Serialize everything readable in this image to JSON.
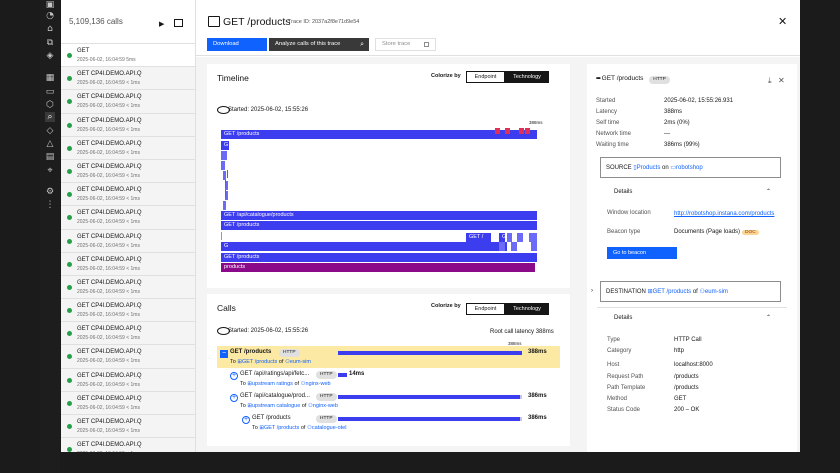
{
  "list": {
    "count": "5,109,136 calls",
    "items": [
      {
        "name": "GET",
        "meta": "2025-06-02, 16:04:59 5ms"
      },
      {
        "name": "GET CP4I.DEMO.API.Q",
        "meta": "2025-06-02, 16:04:59 < 1ms"
      },
      {
        "name": "GET CP4I.DEMO.API.Q",
        "meta": "2025-06-02, 16:04:59 < 1ms"
      },
      {
        "name": "GET CP4I.DEMO.API.Q",
        "meta": "2025-06-02, 16:04:59 < 1ms"
      },
      {
        "name": "GET CP4I.DEMO.API.Q",
        "meta": "2025-06-02, 16:04:59 < 1ms"
      },
      {
        "name": "GET CP4I.DEMO.API.Q",
        "meta": "2025-06-02, 16:04:59 < 1ms"
      },
      {
        "name": "GET CP4I.DEMO.API.Q",
        "meta": "2025-06-02, 16:04:59 < 1ms"
      },
      {
        "name": "GET CP4I.DEMO.API.Q",
        "meta": "2025-06-02, 16:04:59 < 1ms"
      },
      {
        "name": "GET CP4I.DEMO.API.Q",
        "meta": "2025-06-02, 16:04:59 < 1ms"
      },
      {
        "name": "GET CP4I.DEMO.API.Q",
        "meta": "2025-06-02, 16:04:59 < 1ms"
      },
      {
        "name": "GET CP4I.DEMO.API.Q",
        "meta": "2025-06-02, 16:04:59 < 1ms"
      },
      {
        "name": "GET CP4I.DEMO.API.Q",
        "meta": "2025-06-02, 16:04:59 < 1ms"
      },
      {
        "name": "GET CP4I.DEMO.API.Q",
        "meta": "2025-06-02, 16:04:59 < 1ms"
      },
      {
        "name": "GET CP4I.DEMO.API.Q",
        "meta": "2025-06-02, 16:04:59 < 1ms"
      },
      {
        "name": "GET CP4I.DEMO.API.Q",
        "meta": "2025-06-02, 16:04:59 < 1ms"
      },
      {
        "name": "GET CP4I.DEMO.API.Q",
        "meta": "2025-06-02, 16:04:59 < 1ms"
      },
      {
        "name": "GET CP4I.DEMO.API.Q",
        "meta": "2025-06-02, 16:04:59 < 1ms"
      },
      {
        "name": "GET CP4I.DEMO.API.Q",
        "meta": "2025-06-02, 16:04:59 < 1ms"
      }
    ]
  },
  "header": {
    "title": "GET /products",
    "trace_id": "Trace ID: 2037a2f8e71d9e54",
    "download": "Download",
    "analyze": "Analyze calls of this trace",
    "store": "Store trace"
  },
  "timeline": {
    "title": "Timeline",
    "colorize": "Colorize by",
    "opt_endpoint": "Endpoint",
    "opt_technology": "Technology",
    "started": "Started: 2025-06-02, 15:55:26",
    "total": "388ms",
    "bars": [
      {
        "label": "GET /products"
      },
      {
        "label": "G"
      },
      {
        "label": "GET /api/catalogue/products"
      },
      {
        "label": "GET /products"
      },
      {
        "label": "GET /"
      },
      {
        "label": "G"
      },
      {
        "label": "GET /"
      },
      {
        "label": "GET /products"
      },
      {
        "label": "products"
      }
    ]
  },
  "calls": {
    "title": "Calls",
    "colorize": "Colorize by",
    "opt_endpoint": "Endpoint",
    "opt_technology": "Technology",
    "started": "Started: 2025-06-02, 15:55:26",
    "root_latency": "Root call latency 388ms",
    "total": "388ms",
    "rows": [
      {
        "name": "GET /products",
        "tag": "HTTP",
        "to_prefix": "To",
        "to_target": "GET /products",
        "of": "of",
        "service": "eum-sim",
        "latency": "388ms"
      },
      {
        "name": "GET /api/ratings/api/fetc...",
        "tag": "HTTP",
        "to_prefix": "To",
        "to_target": "upstream ratings",
        "of": "of",
        "service": "nginx-web",
        "latency": "14ms"
      },
      {
        "name": "GET /api/catalogue/prod...",
        "tag": "HTTP",
        "to_prefix": "To",
        "to_target": "upstream catalogue",
        "of": "of",
        "service": "nginx-web",
        "latency": "386ms"
      },
      {
        "name": "GET /products",
        "tag": "HTTP",
        "to_prefix": "To",
        "to_target": "GET /products",
        "of": "of",
        "service": "catalogue-otel",
        "latency": "386ms"
      }
    ]
  },
  "side": {
    "title": "GET /products",
    "tag": "HTTP",
    "fields": [
      {
        "k": "Started",
        "v": "2025-06-02, 15:55:26.931"
      },
      {
        "k": "Latency",
        "v": "388ms"
      },
      {
        "k": "Self time",
        "v": "2ms (0%)"
      },
      {
        "k": "Network time",
        "v": "—"
      },
      {
        "k": "Waiting time",
        "v": "386ms (99%)"
      }
    ],
    "source_label": "SOURCE",
    "source_name": "Products",
    "source_on": "on",
    "source_app": "robotshop",
    "details": "Details",
    "window_k": "Window location",
    "window_v": "http://robotshop.instana.com/products",
    "beacon_k": "Beacon type",
    "beacon_v": "Documents (Page loads)",
    "beacon_tag": "DOC",
    "go": "Go to beacon",
    "dest_label": "DESTINATION",
    "dest_name": "GET /products",
    "dest_of": "of",
    "dest_service": "eum-sim",
    "details2": "Details",
    "dest_fields": [
      {
        "k": "Type",
        "v": "HTTP Call"
      },
      {
        "k": "Category",
        "v": "http"
      },
      {
        "k": "Host",
        "v": "localhost:8000"
      },
      {
        "k": "Request Path",
        "v": "/products"
      },
      {
        "k": "Path Template",
        "v": "/products"
      },
      {
        "k": "Method",
        "v": "GET"
      },
      {
        "k": "Status Code",
        "v": "200 – OK"
      }
    ]
  },
  "colors": {
    "accent": "#0f62fe",
    "bar": "#3d3df0",
    "purple": "#8a0a8a",
    "highlight": "#fce9a4",
    "ok": "#24a148",
    "error": "#e03058"
  }
}
